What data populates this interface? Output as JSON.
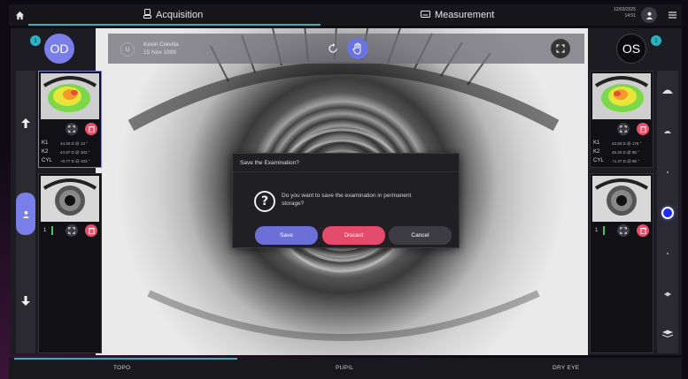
{
  "topbar": {
    "tabs": [
      {
        "label": "Acquisition",
        "icon": "camera-icon",
        "active": true
      },
      {
        "label": "Measurement",
        "icon": "keyboard-icon",
        "active": false
      }
    ],
    "date": "12/03/2025",
    "time": "14:51"
  },
  "patient": {
    "initial": "U",
    "name": "Kevin Crevilla",
    "dob": "15 Nov 1999"
  },
  "eyes": {
    "od_label": "OD",
    "os_label": "OS",
    "od_count": "1",
    "os_count": "1"
  },
  "left_panel": {
    "topo": {
      "k1_label": "K1",
      "k1_value": "44.20 D @ 13 °",
      "k2_label": "K2",
      "k2_value": "44.97 D @ 103 °",
      "cyl_label": "CYL",
      "cyl_value": "+0.77 D @ 103 °"
    },
    "pupil": {
      "count": "1"
    }
  },
  "right_panel": {
    "topo": {
      "k1_label": "K1",
      "k1_value": "43.93 D @ 175 °",
      "k2_label": "K2",
      "k2_value": "45.20 D @ 85 °",
      "cyl_label": "CYL",
      "cyl_value": "+1.27 D @ 85 °"
    },
    "pupil": {
      "count": "1"
    }
  },
  "dialog": {
    "title": "Save the Examination?",
    "message": "Do you want to save the examination in permanent storage?",
    "save": "Save",
    "discard": "Discard",
    "cancel": "Cancel"
  },
  "bottombar": {
    "tabs": [
      "TOPO",
      "PUPIL",
      "DRY EYE"
    ]
  },
  "colors": {
    "accent": "#7a7ee8",
    "teal": "#2bb3c0",
    "discard": "#e44a6a",
    "active_dot": "#1a2cff"
  }
}
